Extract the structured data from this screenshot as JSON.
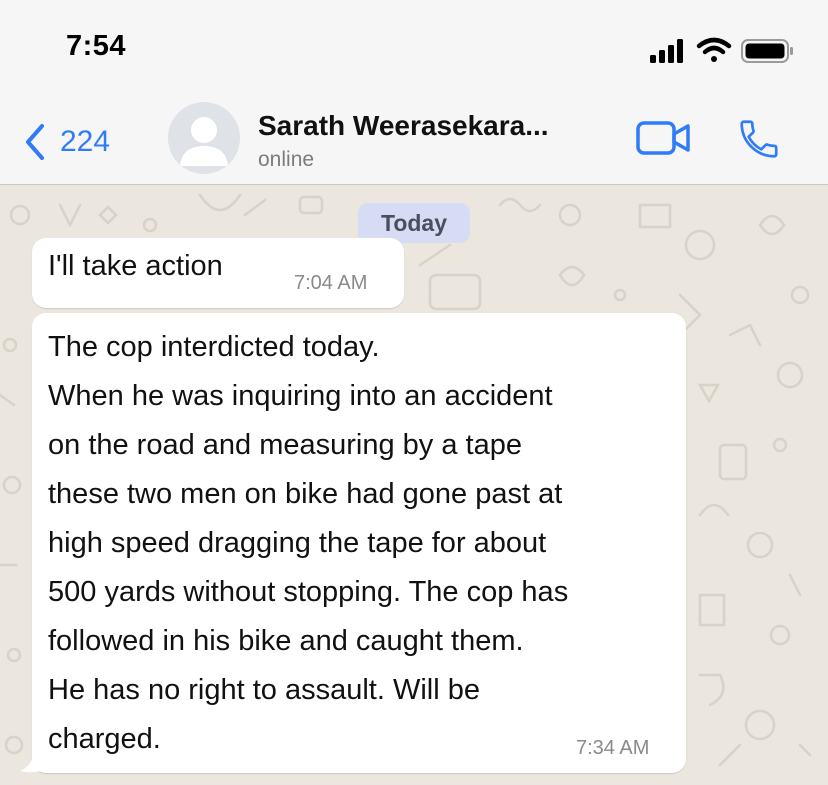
{
  "status_bar": {
    "time": "7:54",
    "icons": [
      "cellular-signal-icon",
      "wifi-icon",
      "battery-icon"
    ]
  },
  "header": {
    "back_count": "224",
    "contact_name": "Sarath Weerasekara...",
    "contact_status": "online",
    "accent_color": "#2f7cf6",
    "icons": [
      "back-chevron-icon",
      "avatar-placeholder-icon",
      "video-call-icon",
      "phone-icon"
    ]
  },
  "chat": {
    "date_label": "Today",
    "messages": [
      {
        "text": "I'll take action",
        "time": "7:04 AM"
      },
      {
        "text": "The cop interdicted today.\nWhen he was inquiring into an accident\non the road and measuring by a tape\nthese two men on bike had gone past at\nhigh speed dragging the tape for about\n500 yards without stopping. The cop has\nfollowed in his bike and caught them.\nHe has no right to assault. Will be\ncharged.",
        "time": "7:34 AM"
      }
    ],
    "colors": {
      "wallpaper": "#ebe6de",
      "bubble": "#ffffff",
      "date_pill": "#d5dcf4"
    }
  }
}
